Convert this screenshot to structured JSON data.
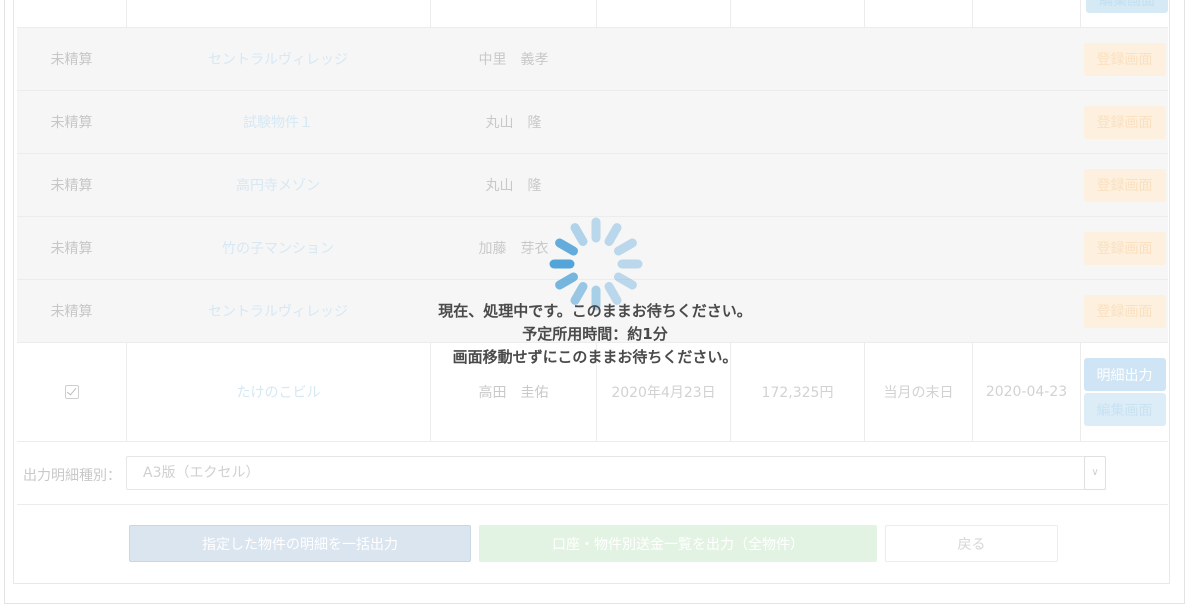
{
  "table": {
    "top_button": "編集画面",
    "rows": [
      {
        "status": "未精算",
        "property": "セントラルヴィレッジ",
        "owner": "中里　義孝",
        "action": "登録画面"
      },
      {
        "status": "未精算",
        "property": "試験物件１",
        "owner": "丸山　隆",
        "action": "登録画面"
      },
      {
        "status": "未精算",
        "property": "高円寺メゾン",
        "owner": "丸山　隆",
        "action": "登録画面"
      },
      {
        "status": "未精算",
        "property": "竹の子マンション",
        "owner": "加藤　芽衣",
        "action": "登録画面"
      },
      {
        "status": "未精算",
        "property": "セントラルヴィレッジ",
        "owner": "",
        "action": "登録画面"
      }
    ],
    "checked_row": {
      "property": "たけのこビル",
      "owner": "高田　圭佑",
      "date": "2020年4月23日",
      "amount": "172,325円",
      "due": "当月の末日",
      "iso_date": "2020-04-23",
      "detail_button": "明細出力",
      "edit_button": "編集画面"
    }
  },
  "output": {
    "label": "出力明細種別：",
    "selected": "A3版（エクセル）"
  },
  "buttons": {
    "bulk": "指定した物件の明細を一括出力",
    "account": "口座・物件別送金一覧を出力（全物件）",
    "back": "戻る"
  },
  "overlay": {
    "line1": "現在、処理中です。このままお待ちください。",
    "line2": "予定所用時間：約1分",
    "line3": "画面移動せずにこのままお待ちください。"
  },
  "colors": {
    "spinner": "#4a9fd6"
  }
}
